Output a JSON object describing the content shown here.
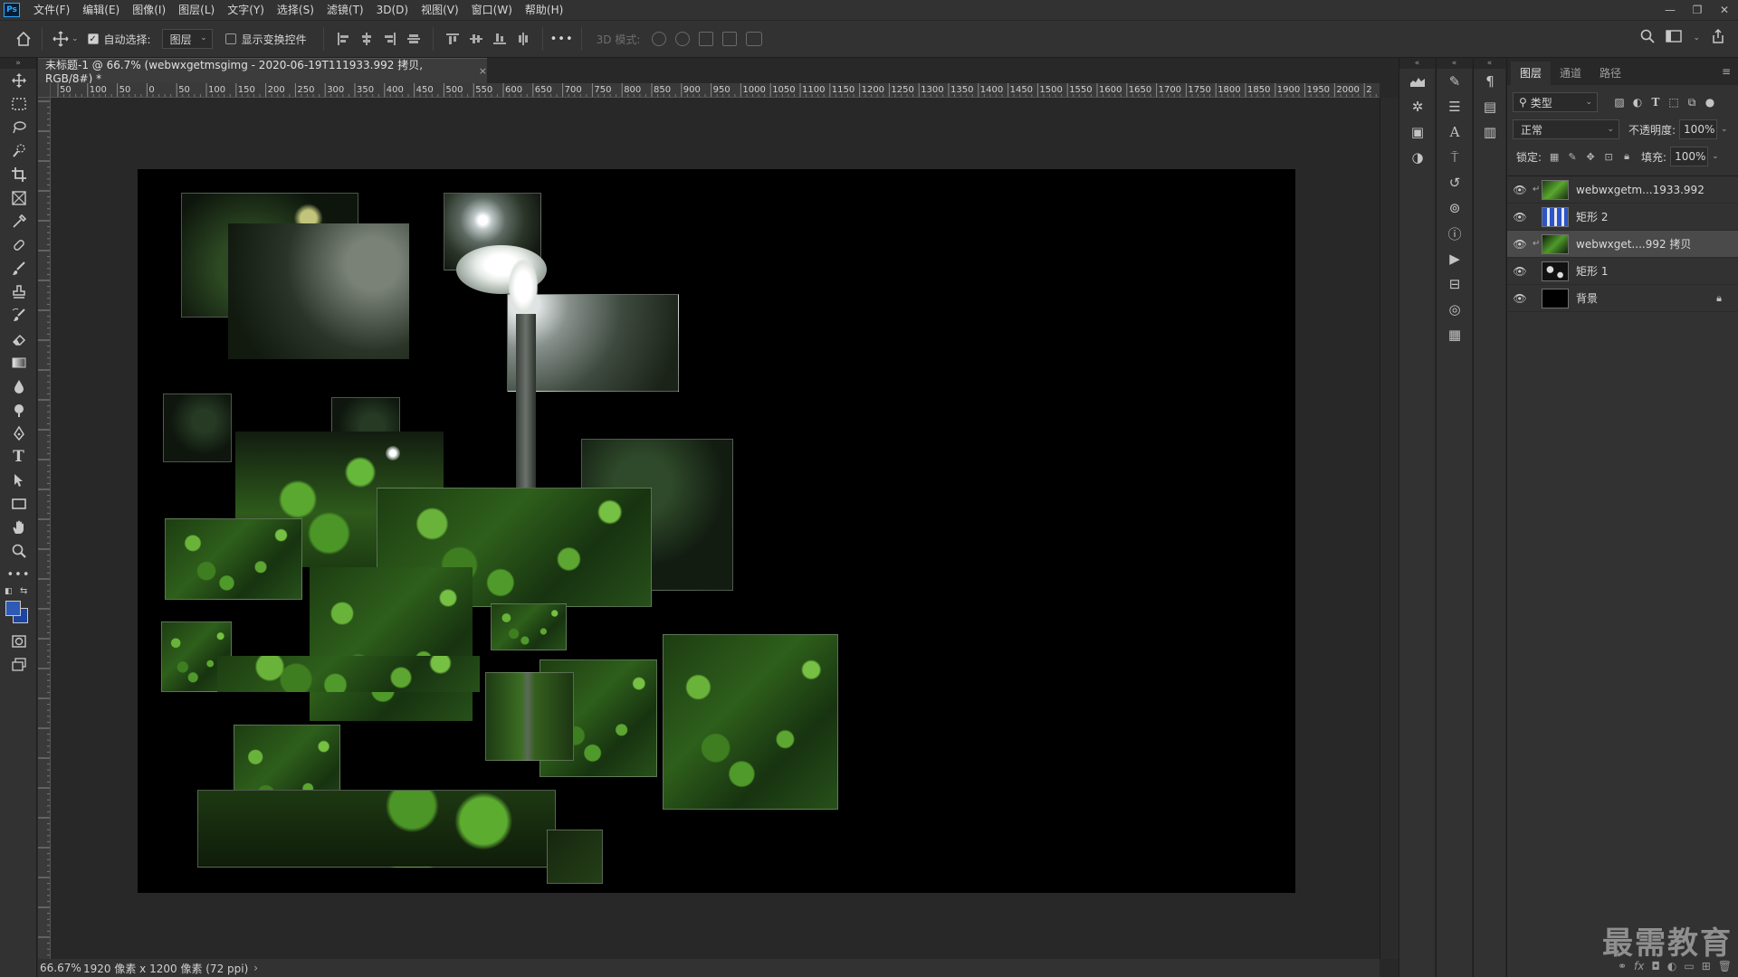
{
  "app": {
    "logo": "Ps"
  },
  "menu": [
    "文件(F)",
    "编辑(E)",
    "图像(I)",
    "图层(L)",
    "文字(Y)",
    "选择(S)",
    "滤镜(T)",
    "3D(D)",
    "视图(V)",
    "窗口(W)",
    "帮助(H)"
  ],
  "options": {
    "auto_select_label": "自动选择:",
    "auto_select_checked": true,
    "auto_select_target": "图层",
    "show_transform_label": "显示变换控件",
    "show_transform_checked": false,
    "mode_3d_label": "3D 模式:",
    "more_label": "•••"
  },
  "document": {
    "tab_title": "未标题-1 @ 66.7% (webwxgetmsgimg - 2020-06-19T111933.992 拷贝, RGB/8#) *",
    "close": "×",
    "ruler_top": [
      "50",
      "100",
      "50",
      "0",
      "50",
      "100",
      "150",
      "200",
      "250",
      "300",
      "350",
      "400",
      "450",
      "500",
      "550",
      "600",
      "650",
      "700",
      "750",
      "800",
      "850",
      "900",
      "950",
      "1000",
      "1050",
      "1100",
      "1150",
      "1200",
      "1250",
      "1300",
      "1350",
      "1400",
      "1450",
      "1500",
      "1550",
      "1600",
      "1650",
      "1700",
      "1750",
      "1800",
      "1850",
      "1900",
      "1950",
      "2000",
      "2"
    ],
    "status_zoom": "66.67%",
    "status_info": "1920 像素 x 1200 像素 (72 ppi)"
  },
  "layers_panel": {
    "tabs": [
      "图层",
      "通道",
      "路径"
    ],
    "filter_label": "类型",
    "blend_mode": "正常",
    "opacity_label": "不透明度:",
    "opacity_value": "100%",
    "lock_label": "锁定:",
    "fill_label": "填充:",
    "fill_value": "100%",
    "layers": [
      {
        "name": "webwxgetm...1933.992",
        "clipped": true,
        "selected": false,
        "locked": false
      },
      {
        "name": "矩形 2",
        "clipped": false,
        "selected": false,
        "locked": false
      },
      {
        "name": "webwxget....992 拷贝",
        "clipped": true,
        "selected": true,
        "locked": false
      },
      {
        "name": "矩形 1",
        "clipped": false,
        "selected": false,
        "locked": false
      },
      {
        "name": "背景",
        "clipped": false,
        "selected": false,
        "locked": true
      }
    ],
    "footer_icons": [
      "link-icon",
      "fx-icon",
      "mask-icon",
      "adjustment-icon",
      "group-icon",
      "new-layer-icon",
      "trash-icon"
    ]
  },
  "colors": {
    "foreground": "#2e5ab5",
    "background": "#1c44a0",
    "accent": "#31a8ff"
  },
  "watermark": "最需教育"
}
